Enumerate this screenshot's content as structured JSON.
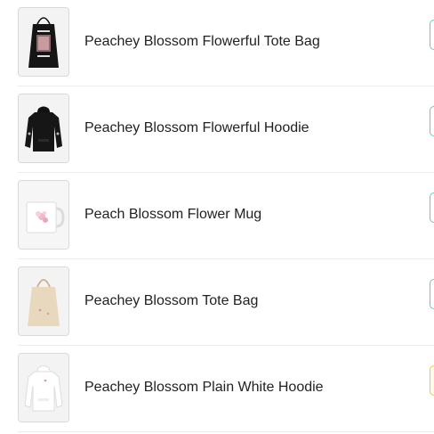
{
  "products": [
    {
      "name": "Peachey Blossom Flowerful Tote Bag",
      "image_icon": "black-tote-bag-icon",
      "status_color": "#6fc9a8"
    },
    {
      "name": "Peachey Blossom Flowerful Hoodie",
      "image_icon": "black-hoodie-icon",
      "status_color": "#6fc9a8"
    },
    {
      "name": "Peach Blossom Flower Mug",
      "image_icon": "white-mug-icon",
      "status_color": "#6fc9a8"
    },
    {
      "name": "Peachey Blossom Tote Bag",
      "image_icon": "natural-tote-bag-icon",
      "status_color": "#6fc9a8"
    },
    {
      "name": "Peachey Blossom Plain White Hoodie",
      "image_icon": "white-hoodie-icon",
      "status_color": "#e8cc4a"
    }
  ]
}
